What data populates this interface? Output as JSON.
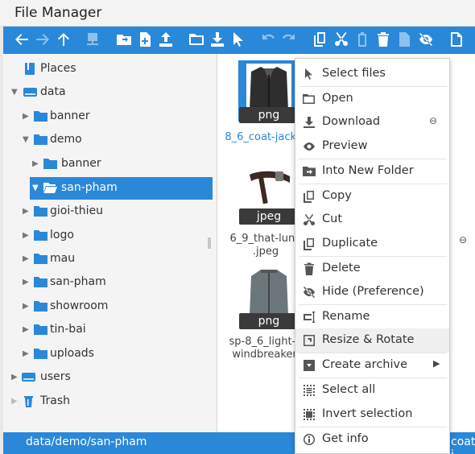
{
  "app": {
    "title": "File Manager"
  },
  "toolbar": {
    "buttons": [
      "back-icon",
      "forward-icon",
      "up-icon",
      "netmount-icon",
      "open-icon",
      "mkfile-icon",
      "upload-icon",
      "mkdir-icon",
      "download-icon",
      "select-icon",
      "undo-icon",
      "redo-icon",
      "copy-icon",
      "cut-icon",
      "paste-icon",
      "delete-icon",
      "empty-icon",
      "hide-icon",
      "view-icon"
    ]
  },
  "tree": {
    "items": [
      {
        "label": "Places",
        "icon": "places-icon"
      },
      {
        "label": "data",
        "icon": "drive-icon"
      },
      {
        "label": "banner",
        "icon": "folder-icon"
      },
      {
        "label": "demo",
        "icon": "folder-icon"
      },
      {
        "label": "banner",
        "icon": "folder-icon"
      },
      {
        "label": "san-pham",
        "icon": "folder-open-icon"
      },
      {
        "label": "gioi-thieu",
        "icon": "folder-icon"
      },
      {
        "label": "logo",
        "icon": "folder-icon"
      },
      {
        "label": "mau",
        "icon": "folder-icon"
      },
      {
        "label": "san-pham",
        "icon": "folder-icon"
      },
      {
        "label": "showroom",
        "icon": "folder-icon"
      },
      {
        "label": "tin-bai",
        "icon": "folder-icon"
      },
      {
        "label": "uploads",
        "icon": "folder-icon"
      },
      {
        "label": "users",
        "icon": "drive-icon"
      },
      {
        "label": "Trash",
        "icon": "trash-icon"
      }
    ]
  },
  "files": [
    {
      "badge": "png",
      "name1": "8_6_coat-jacket",
      "name2": "",
      "selected": true
    },
    {
      "badge": "jpeg",
      "name1": "6_9_that-lung",
      "name2": ".jpeg",
      "selected": false
    },
    {
      "badge": "png",
      "name1": "sp-8_6_light-b",
      "name2": "windbreaker.",
      "selected": false
    }
  ],
  "context_menu": {
    "items": [
      {
        "label": "Select files",
        "icon": "cursor-icon"
      },
      {
        "label": "Open",
        "icon": "folder-open-icon"
      },
      {
        "label": "Download",
        "icon": "download-icon",
        "extra": "link-icon"
      },
      {
        "label": "Preview",
        "icon": "eye-icon"
      },
      {
        "label": "Into New Folder",
        "icon": "into-folder-icon"
      },
      {
        "label": "Copy",
        "icon": "copy-icon"
      },
      {
        "label": "Cut",
        "icon": "scissors-icon"
      },
      {
        "label": "Duplicate",
        "icon": "duplicate-icon"
      },
      {
        "label": "Delete",
        "icon": "trash-icon"
      },
      {
        "label": "Hide (Preference)",
        "icon": "hide-icon"
      },
      {
        "label": "Rename",
        "icon": "rename-icon"
      },
      {
        "label": "Resize & Rotate",
        "icon": "resize-icon"
      },
      {
        "label": "Create archive",
        "icon": "archive-icon",
        "submenu": true
      },
      {
        "label": "Select all",
        "icon": "select-all-icon"
      },
      {
        "label": "Invert selection",
        "icon": "invert-icon"
      },
      {
        "label": "Get info",
        "icon": "info-icon"
      }
    ]
  },
  "statusbar": {
    "path": "data/demo/san-pham",
    "right": "coat-j"
  },
  "colors": {
    "accent": "#2a88d8",
    "pane": "#f4f4f4"
  }
}
